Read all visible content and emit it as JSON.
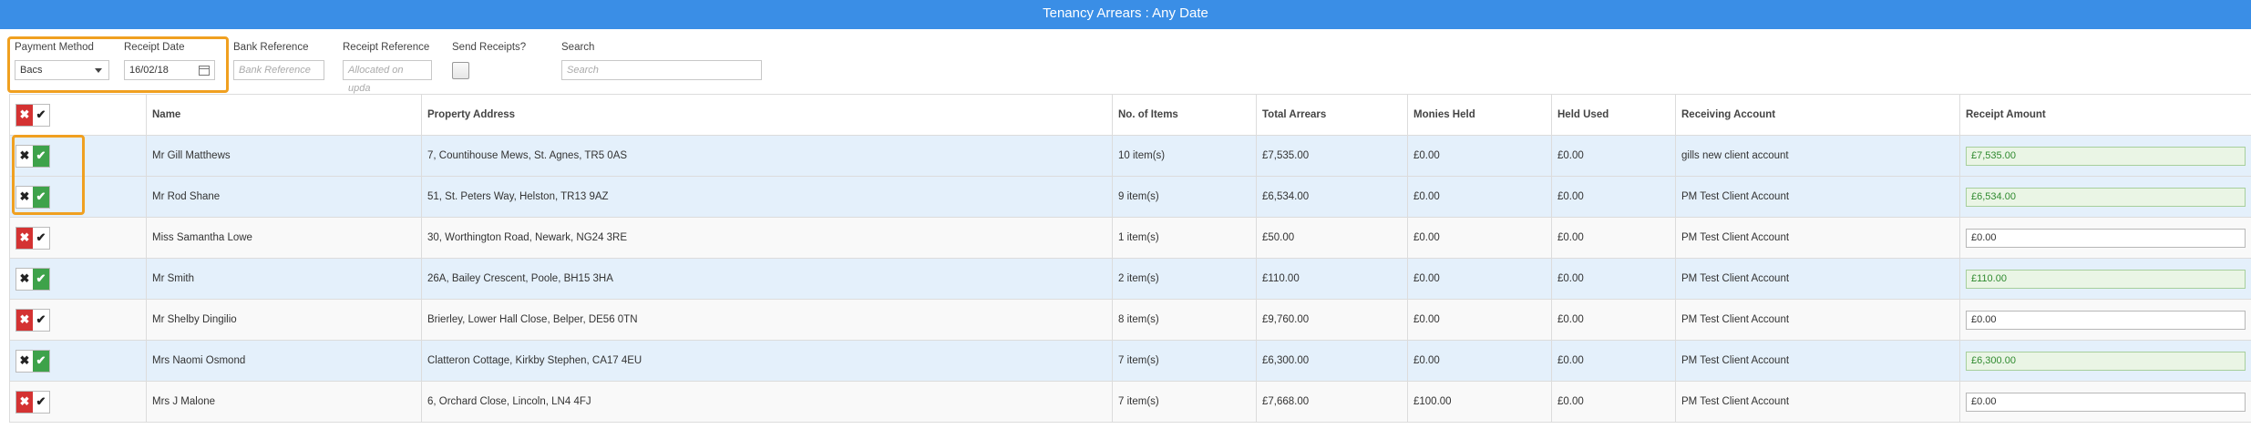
{
  "window": {
    "title": "Tenancy Arrears : Any Date"
  },
  "filters": {
    "payment_method": {
      "label": "Payment Method",
      "value": "Bacs"
    },
    "receipt_date": {
      "label": "Receipt Date",
      "value": "16/02/18"
    },
    "bank_reference": {
      "label": "Bank Reference",
      "placeholder": "Bank Reference"
    },
    "receipt_reference": {
      "label": "Receipt Reference",
      "placeholder": "Allocated on upda"
    },
    "send_receipts": {
      "label": "Send Receipts?"
    },
    "search": {
      "label": "Search",
      "placeholder": "Search"
    }
  },
  "columns": [
    "Name",
    "Property Address",
    "No. of Items",
    "Total Arrears",
    "Monies Held",
    "Held Used",
    "Receiving Account",
    "Receipt Amount"
  ],
  "toggle": {
    "no_glyph": "✖",
    "yes_glyph": "✔"
  },
  "rows": [
    {
      "selected": true,
      "name": "Mr Gill Matthews",
      "address": "7, Countihouse Mews, St. Agnes, TR5 0AS",
      "items": "10 item(s)",
      "arrears": "£7,535.00",
      "held": "£0.00",
      "used": "£0.00",
      "account": "gills new client account",
      "amount": "£7,535.00"
    },
    {
      "selected": true,
      "name": "Mr Rod Shane",
      "address": "51, St. Peters Way, Helston, TR13 9AZ",
      "items": "9 item(s)",
      "arrears": "£6,534.00",
      "held": "£0.00",
      "used": "£0.00",
      "account": "PM Test Client Account",
      "amount": "£6,534.00"
    },
    {
      "selected": false,
      "name": "Miss Samantha Lowe",
      "address": "30, Worthington Road, Newark, NG24 3RE",
      "items": "1 item(s)",
      "arrears": "£50.00",
      "held": "£0.00",
      "used": "£0.00",
      "account": "PM Test Client Account",
      "amount": "£0.00"
    },
    {
      "selected": true,
      "name": "Mr Smith",
      "address": "26A, Bailey Crescent, Poole, BH15 3HA",
      "items": "2 item(s)",
      "arrears": "£110.00",
      "held": "£0.00",
      "used": "£0.00",
      "account": "PM Test Client Account",
      "amount": "£110.00"
    },
    {
      "selected": false,
      "name": "Mr Shelby Dingilio",
      "address": "Brierley, Lower Hall Close, Belper, DE56 0TN",
      "items": "8 item(s)",
      "arrears": "£9,760.00",
      "held": "£0.00",
      "used": "£0.00",
      "account": "PM Test Client Account",
      "amount": "£0.00"
    },
    {
      "selected": true,
      "name": "Mrs Naomi Osmond",
      "address": "Clatteron Cottage, Kirkby Stephen, CA17 4EU",
      "items": "7 item(s)",
      "arrears": "£6,300.00",
      "held": "£0.00",
      "used": "£0.00",
      "account": "PM Test Client Account",
      "amount": "£6,300.00"
    },
    {
      "selected": false,
      "name": "Mrs J Malone",
      "address": "6, Orchard Close, Lincoln, LN4 4FJ",
      "items": "7 item(s)",
      "arrears": "£7,668.00",
      "held": "£100.00",
      "used": "£0.00",
      "account": "PM Test Client Account",
      "amount": "£0.00"
    }
  ]
}
